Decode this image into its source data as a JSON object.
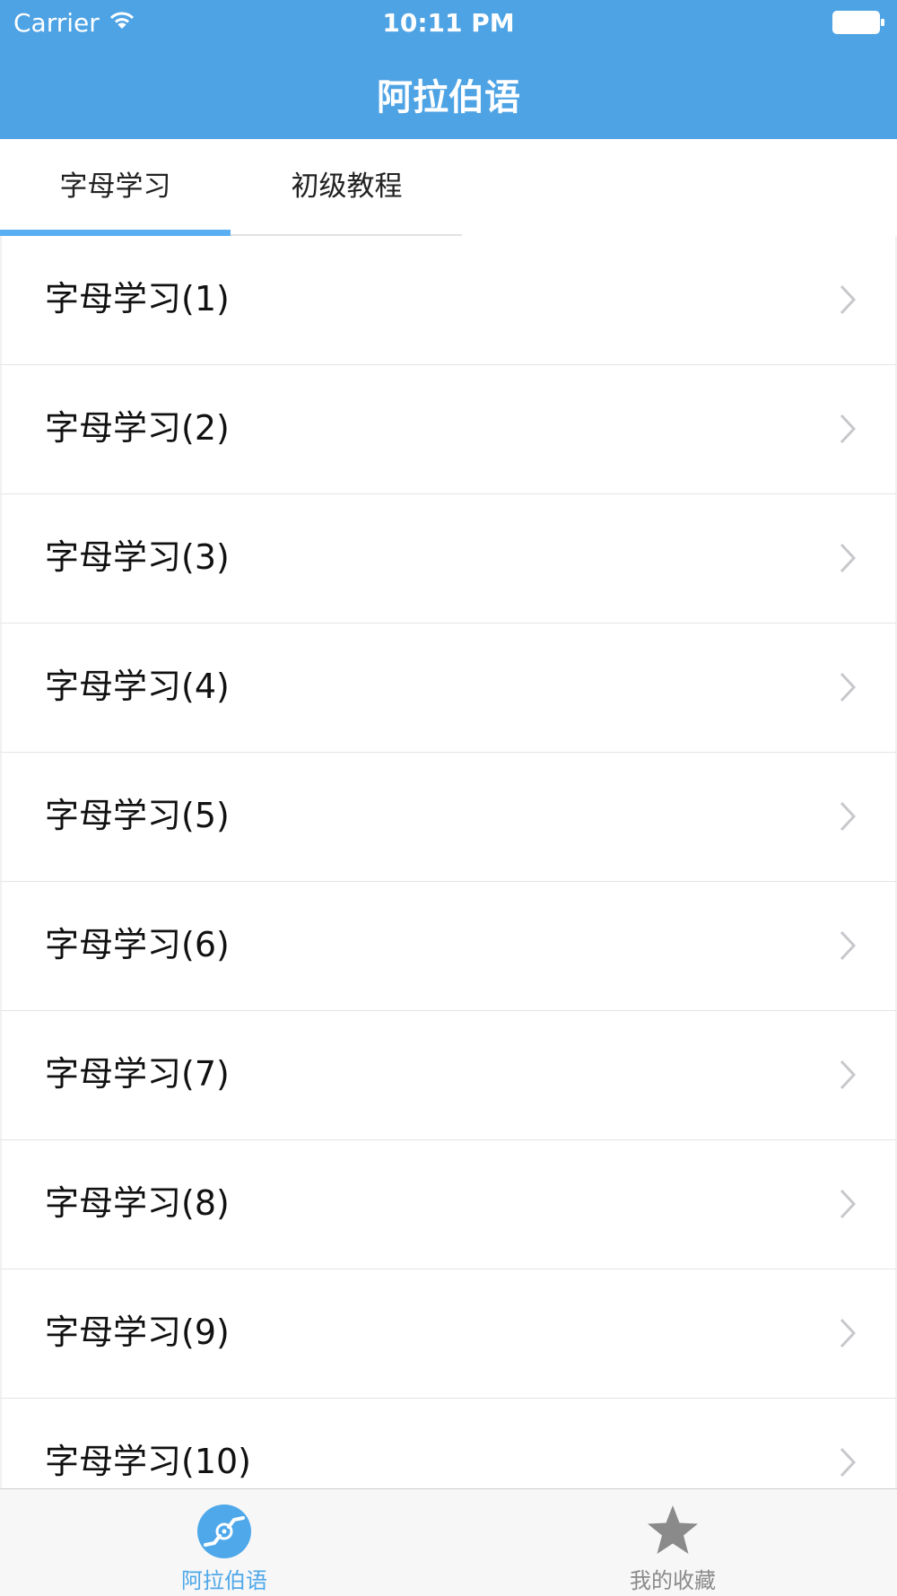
{
  "status_bar": {
    "carrier": "Carrier",
    "time": "10:11 PM"
  },
  "nav": {
    "title": "阿拉伯语"
  },
  "segments": [
    {
      "label": "字母学习",
      "selected": true
    },
    {
      "label": "初级教程",
      "selected": false
    }
  ],
  "list": {
    "items": [
      "字母学习(1)",
      "字母学习(2)",
      "字母学习(3)",
      "字母学习(4)",
      "字母学习(5)",
      "字母学习(6)",
      "字母学习(7)",
      "字母学习(8)",
      "字母学习(9)",
      "字母学习(10)"
    ]
  },
  "tabbar": {
    "tabs": [
      {
        "label": "阿拉伯语",
        "icon": "disc-icon",
        "selected": true
      },
      {
        "label": "我的收藏",
        "icon": "star-icon",
        "selected": false
      }
    ]
  },
  "colors": {
    "header": "#4ea3e4",
    "accent": "#5aaef2",
    "tab_active": "#4ea8ea",
    "tab_inactive": "#8a8a8a"
  }
}
